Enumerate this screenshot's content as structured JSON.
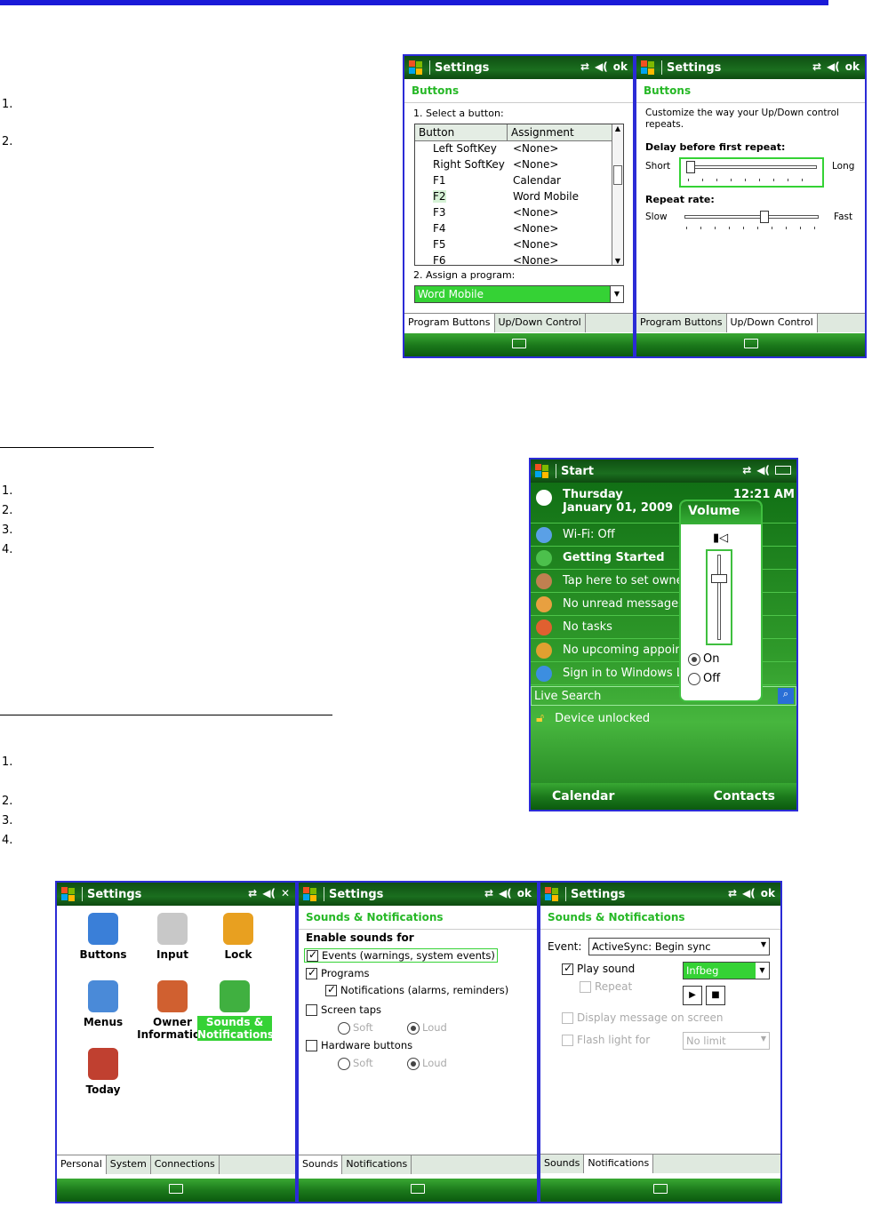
{
  "doc": {
    "list1": [
      "1.",
      "2."
    ],
    "list2": [
      "1.",
      "2.",
      "3.",
      "4."
    ],
    "list3": [
      "1.",
      "2.",
      "3.",
      "4."
    ]
  },
  "buttons_screen": {
    "title": "Settings",
    "ok": "ok",
    "header": "Buttons",
    "step1": "1. Select a button:",
    "col_button": "Button",
    "col_assignment": "Assignment",
    "rows": [
      {
        "button": "Left SoftKey",
        "assignment": "<None>"
      },
      {
        "button": "Right SoftKey",
        "assignment": "<None>"
      },
      {
        "button": "F1",
        "assignment": "Calendar"
      },
      {
        "button": "F2",
        "assignment": "Word Mobile"
      },
      {
        "button": "F3",
        "assignment": "<None>"
      },
      {
        "button": "F4",
        "assignment": "<None>"
      },
      {
        "button": "F5",
        "assignment": "<None>"
      },
      {
        "button": "F6",
        "assignment": "<None>"
      }
    ],
    "step2": "2. Assign a program:",
    "program": "Word Mobile",
    "tab1": "Program Buttons",
    "tab2": "Up/Down Control"
  },
  "updown_screen": {
    "title": "Settings",
    "ok": "ok",
    "header": "Buttons",
    "desc": "Customize the way your Up/Down control repeats.",
    "delay_label": "Delay before first repeat:",
    "short": "Short",
    "long": "Long",
    "rate_label": "Repeat rate:",
    "slow": "Slow",
    "fast": "Fast",
    "delay_value": 0.0,
    "rate_value": 0.6,
    "tab1": "Program Buttons",
    "tab2": "Up/Down Control"
  },
  "today_screen": {
    "title": "Start",
    "day": "Thursday",
    "date": "January 01, 2009",
    "time": "12:21 AM",
    "items": [
      "Wi-Fi: Off",
      "Getting Started",
      "Tap here to set owner",
      "No unread messages",
      "No tasks",
      "No upcoming appointm",
      "Sign in to Windows Liv"
    ],
    "search": "Live Search",
    "unlocked": "Device unlocked",
    "soft_left": "Calendar",
    "soft_right": "Contacts",
    "volume": {
      "title": "Volume",
      "on": "On",
      "off": "Off",
      "level": 0.25
    }
  },
  "personal_screen": {
    "title": "Settings",
    "icons": [
      {
        "label1": "Buttons",
        "label2": ""
      },
      {
        "label1": "Input",
        "label2": ""
      },
      {
        "label1": "Lock",
        "label2": ""
      },
      {
        "label1": "Menus",
        "label2": ""
      },
      {
        "label1": "Owner",
        "label2": "Information"
      },
      {
        "label1": "Sounds &",
        "label2": "Notifications"
      },
      {
        "label1": "Today",
        "label2": ""
      }
    ],
    "tabs": [
      "Personal",
      "System",
      "Connections"
    ]
  },
  "sounds_screen": {
    "title": "Settings",
    "ok": "ok",
    "header": "Sounds & Notifications",
    "enable": "Enable sounds for",
    "events": "Events (warnings, system events)",
    "programs": "Programs",
    "notifications": "Notifications (alarms, reminders)",
    "screen_taps": "Screen taps",
    "soft": "Soft",
    "loud": "Loud",
    "hardware": "Hardware buttons",
    "tabs": [
      "Sounds",
      "Notifications"
    ]
  },
  "notif_screen": {
    "title": "Settings",
    "ok": "ok",
    "header": "Sounds & Notifications",
    "event_label": "Event:",
    "event_value": "ActiveSync: Begin sync",
    "play": "Play sound",
    "sound_value": "Infbeg",
    "repeat": "Repeat",
    "display": "Display message on screen",
    "flash": "Flash light for",
    "flash_value": "No limit",
    "tabs": [
      "Sounds",
      "Notifications"
    ]
  },
  "colors": {
    "green_bar": "#1b6e1f",
    "accent": "#35d235",
    "border": "#2b2bd6"
  }
}
